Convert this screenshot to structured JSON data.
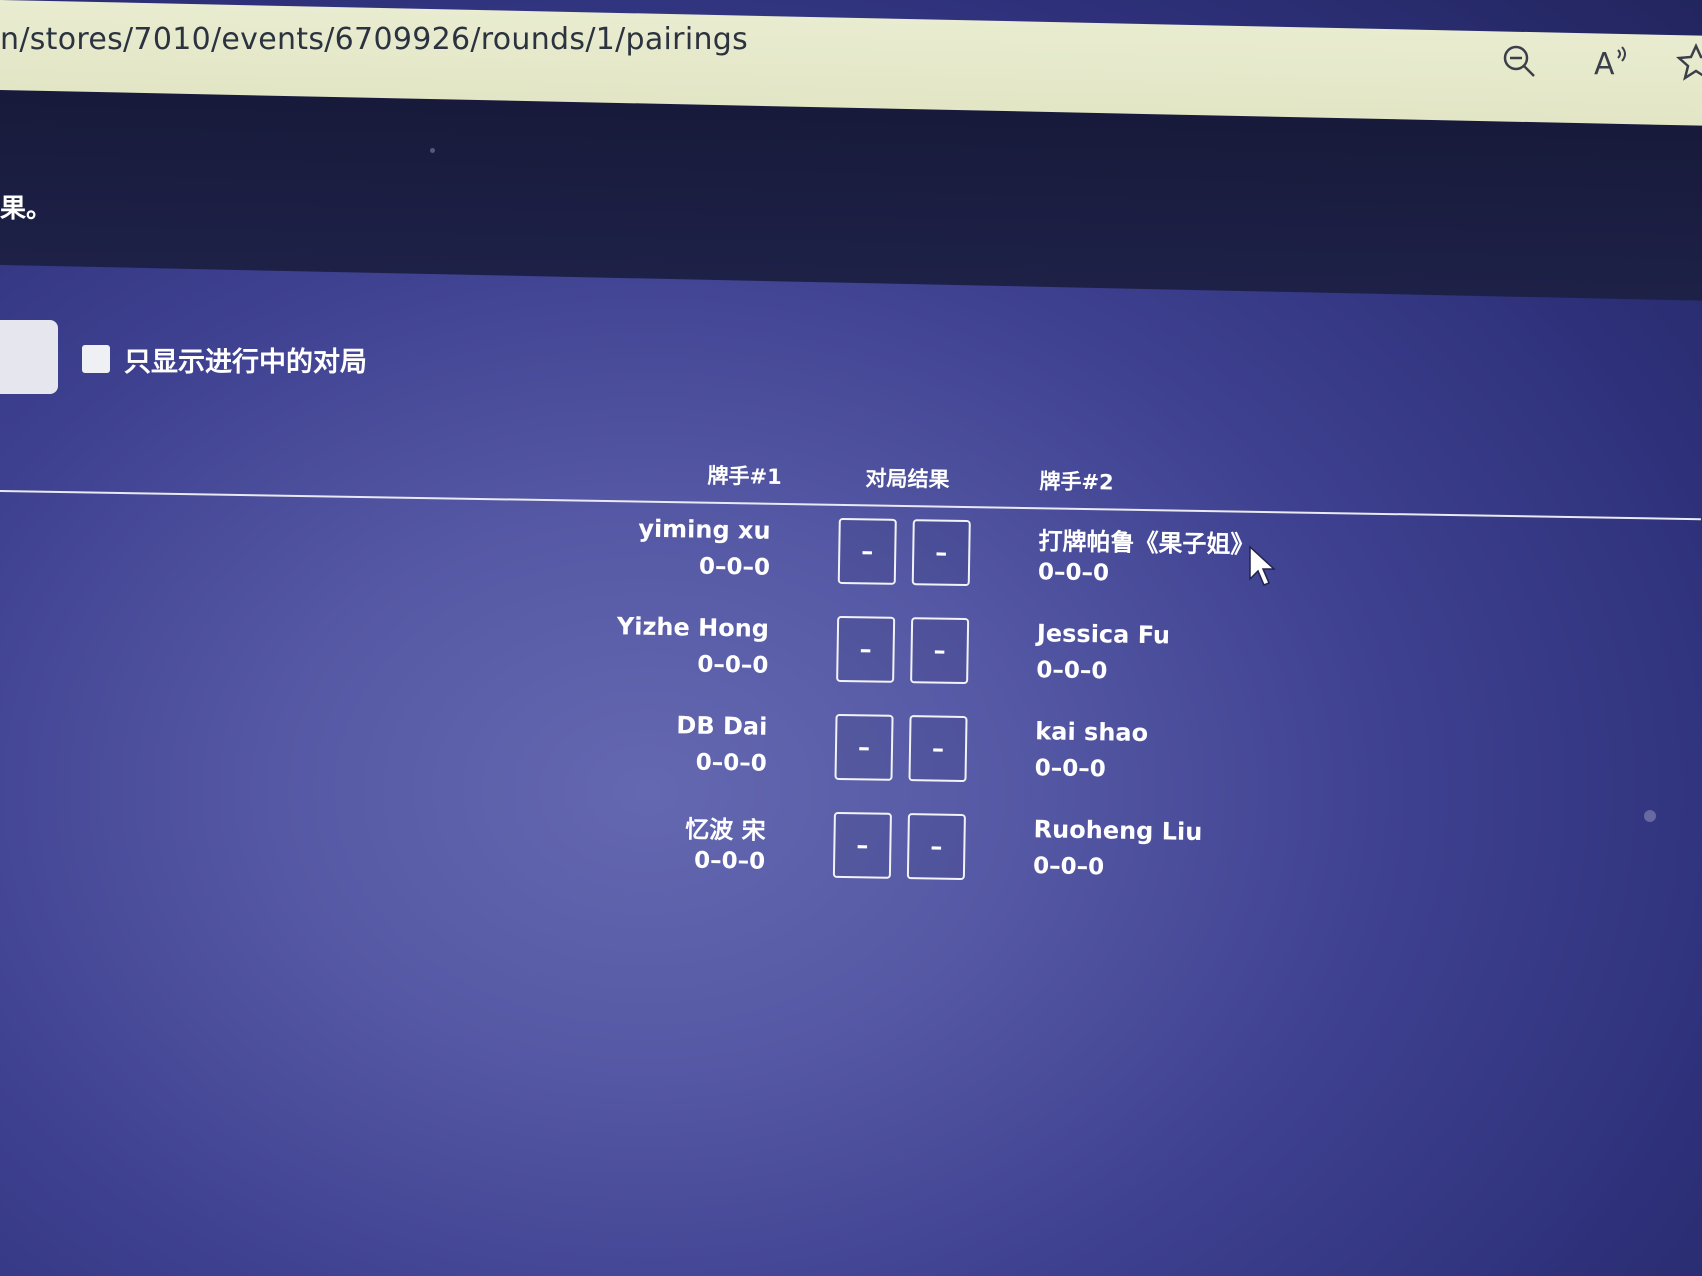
{
  "browser": {
    "url": "n/stores/7010/events/6709926/rounds/1/pairings",
    "icons": [
      "zoom-out-icon",
      "read-aloud-icon",
      "favorite-star-icon"
    ]
  },
  "header": {
    "text": "果。"
  },
  "filter": {
    "checkbox_label": "只显示进行中的对局",
    "checked": false
  },
  "table": {
    "headers": {
      "player1": "牌手#1",
      "result": "对局结果",
      "player2": "牌手#2"
    },
    "rows": [
      {
        "player1": "yiming xu",
        "player1_record": "0–0–0",
        "result_left": "–",
        "result_right": "–",
        "player2": "打牌帕鲁《果子姐》",
        "player2_record": "0–0–0"
      },
      {
        "player1": "Yizhe Hong",
        "player1_record": "0–0–0",
        "result_left": "–",
        "result_right": "–",
        "player2": "Jessica Fu",
        "player2_record": "0–0–0"
      },
      {
        "player1": "DB Dai",
        "player1_record": "0–0–0",
        "result_left": "–",
        "result_right": "–",
        "player2": "kai shao",
        "player2_record": "0–0–0"
      },
      {
        "player1": "忆波 宋",
        "player1_record": "0–0–0",
        "result_left": "–",
        "result_right": "–",
        "player2": "Ruoheng Liu",
        "player2_record": "0–0–0"
      }
    ]
  },
  "colors": {
    "background": "#4a4d9a",
    "header_bg": "#1b1e42",
    "address_bar": "#e6e9c9",
    "text": "#ffffff"
  }
}
